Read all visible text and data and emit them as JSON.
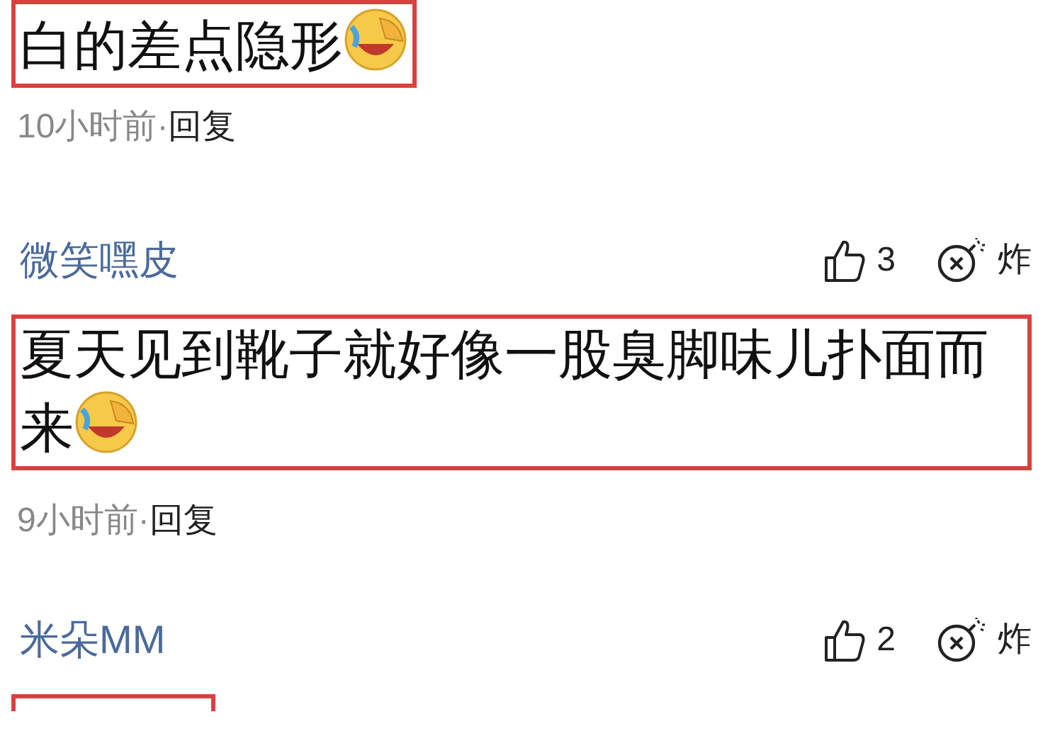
{
  "comments": [
    {
      "text": "白的差点隐形",
      "emoji": true,
      "highlighted": true,
      "time": "10小时前·",
      "reply": "回复"
    },
    {
      "author": "微笑嘿皮",
      "likes": "3",
      "bomb_label": "炸",
      "text": "夏天见到靴子就好像一股臭脚味儿扑面而来",
      "emoji": true,
      "highlighted": true,
      "time": "9小时前·",
      "reply": "回复"
    },
    {
      "author": "米朵MM",
      "likes": "2",
      "bomb_label": "炸",
      "highlighted": true
    }
  ]
}
